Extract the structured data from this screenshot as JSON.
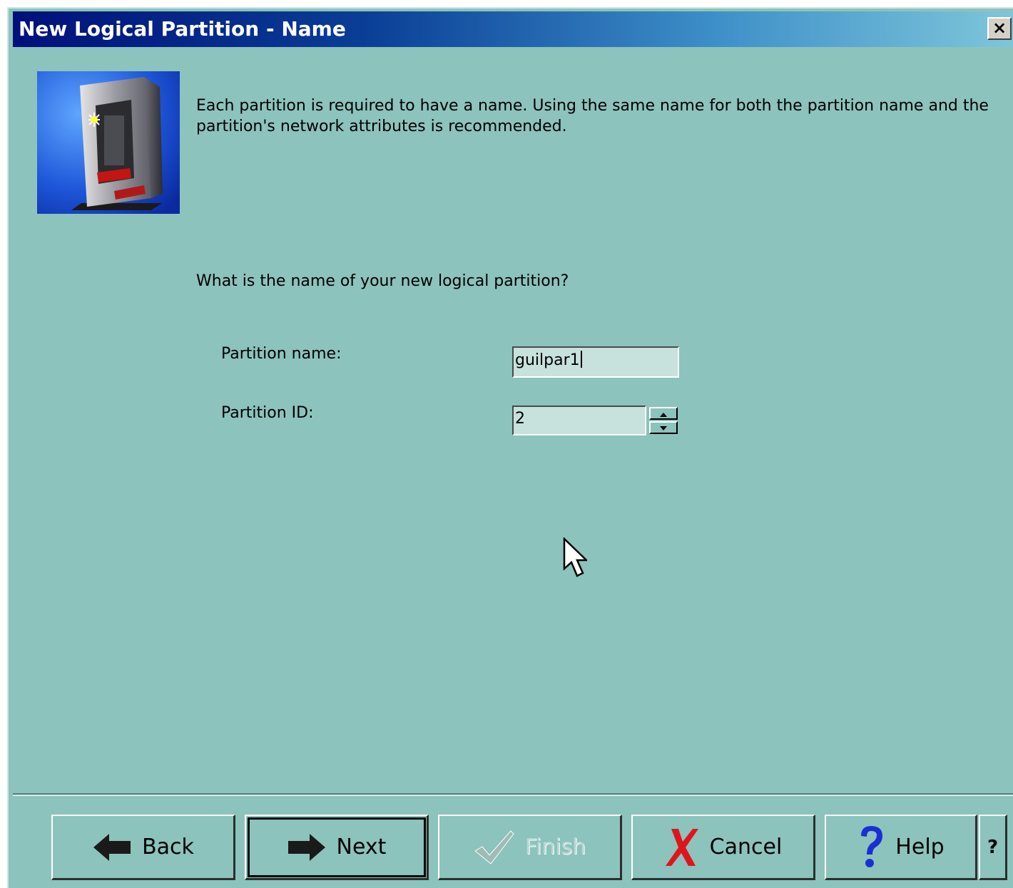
{
  "window": {
    "title": "New Logical Partition - Name",
    "close_glyph": "×"
  },
  "intro_text": "Each partition is required to have a name.  Using the same name for both the partition name and the partition's network attributes is recommended.",
  "question": "What is the name of your new logical partition?",
  "form": {
    "partition_name_label": "Partition name:",
    "partition_name_value": "guilpar1",
    "partition_id_label": "Partition ID:",
    "partition_id_value": "2"
  },
  "buttons": {
    "back": "Back",
    "next": "Next",
    "finish": "Finish",
    "cancel": "Cancel",
    "help": "Help",
    "context_help": "?"
  },
  "icons": {
    "hero": "server-tower-icon",
    "back": "arrow-left-icon",
    "next": "arrow-right-icon",
    "finish": "checkmark-icon",
    "cancel": "red-x-icon",
    "help": "question-mark-icon"
  },
  "colors": {
    "background": "#8cc3bc",
    "field": "#c7e1dc",
    "title_gradient_start": "#00107a",
    "title_gradient_end": "#7ec6da",
    "cancel_red": "#e0151b",
    "help_blue": "#1b2fd6"
  }
}
